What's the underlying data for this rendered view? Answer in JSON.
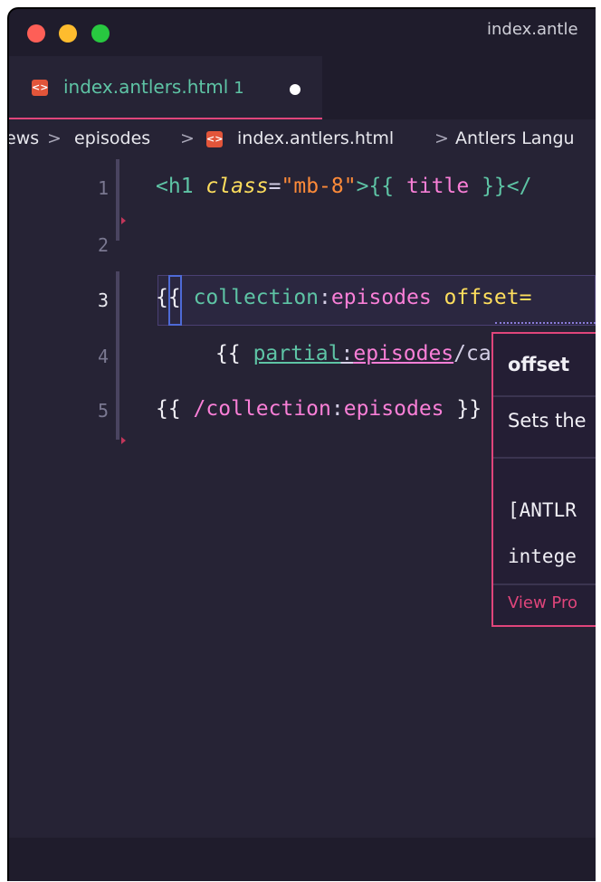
{
  "window": {
    "title": "index.antle"
  },
  "tab": {
    "label": "index.antlers.html",
    "badge": "1",
    "icon": "antlers-file-icon"
  },
  "breadcrumb": [
    {
      "label": "ews"
    },
    {
      "label": "episodes"
    },
    {
      "label": "index.antlers.html"
    },
    {
      "label": "Antlers Langu"
    }
  ],
  "breadcrumb_sep": ">",
  "editor": {
    "line_numbers": [
      "1",
      "2",
      "3",
      "4",
      "5"
    ],
    "lines": {
      "l1": {
        "open": "<h1 ",
        "attr": "class",
        "eq": "=",
        "val": "\"mb-8\"",
        "close": ">{{ ",
        "var": "title",
        "end": " }}</"
      },
      "l3": {
        "open": "{{",
        "space": " ",
        "ns": "collection",
        "colon": ":",
        "name": "episodes",
        "param": " offset="
      },
      "l4": {
        "open": "{{",
        "space": " ",
        "ns": "partial",
        "colon": ":",
        "name": "episodes",
        "rest": "/card }"
      },
      "l5": {
        "open": "{{ ",
        "ns": "/collection",
        "colon": ":",
        "name": "episodes",
        "rest": " }}"
      }
    }
  },
  "hover": {
    "title": "offset",
    "description": "Sets the",
    "code_line1": "[ANTLR",
    "code_line2": "intege",
    "link": "View Pro"
  },
  "colors": {
    "accent": "#e0457b",
    "background": "#262335",
    "tag": "#5ec4a5",
    "attr": "#fede5d",
    "string": "#ff8b39",
    "keyword": "#f97fd7"
  }
}
